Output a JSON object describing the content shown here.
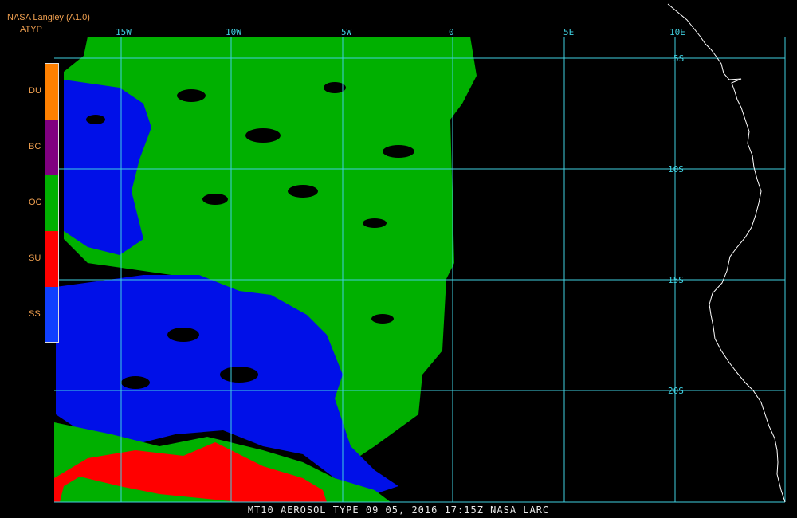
{
  "header": {
    "title": "NASA Langley (A1.0)",
    "product": "ATYP"
  },
  "legend": [
    {
      "code": "DU",
      "color": "#ff8000"
    },
    {
      "code": "BC",
      "color": "#800080"
    },
    {
      "code": "OC",
      "color": "#00b000"
    },
    {
      "code": "SU",
      "color": "#ff0000"
    },
    {
      "code": "SS",
      "color": "#1040ff"
    }
  ],
  "grid": {
    "longitudes": [
      "15W",
      "10W",
      "5W",
      "0",
      "5E",
      "10E"
    ],
    "latitudes": [
      "5S",
      "10S",
      "15S",
      "20S"
    ],
    "color": "#40d0e0"
  },
  "coastline_color": "#ffffff",
  "footer": "MT10  AEROSOL TYPE   09 05, 2016 17:15Z   NASA LARC"
}
